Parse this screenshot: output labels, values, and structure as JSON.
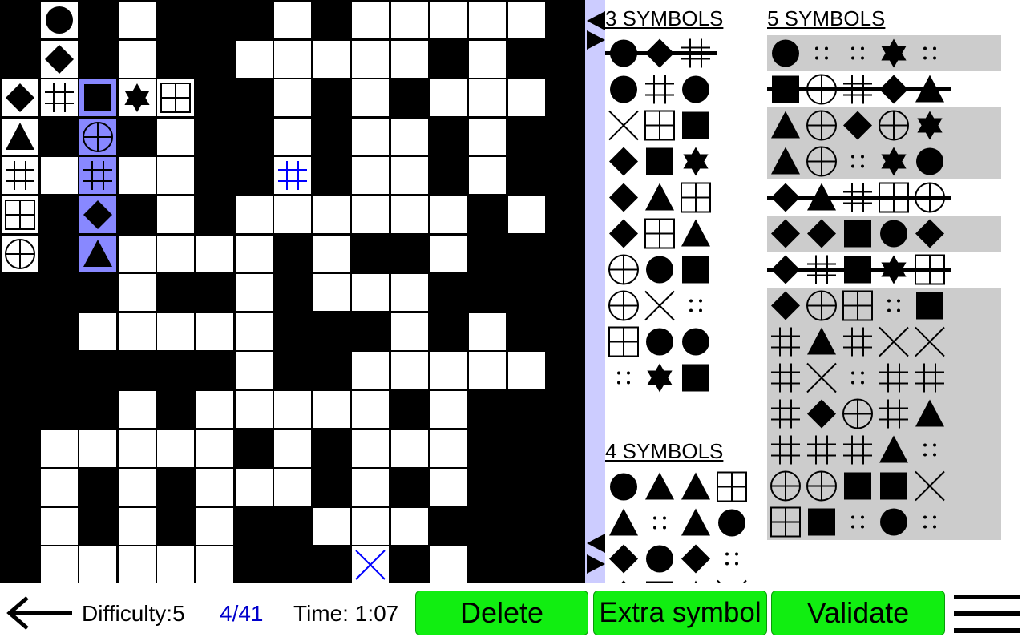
{
  "game": {
    "board": {
      "rows": [
        "#O#.###.#.....",
        "#D#.##.....#.#",
        "DHS*G##.#.#...",
        "T#C#.##.#..#.#",
        "H.H..##h#..#.#",
        "G#D#.#......#.",
        "C#T....#.##.##",
        "###.##.#...###",
        "##.....###.#.#",
        "######.##.....",
        "###.#.....#.##",
        "#.....#.#...##",
        "#.#.#...#.#.##",
        "#.#.#.##...###",
        "#.....###x#.##"
      ],
      "highlighted_column": 2,
      "highlighted_rows": [
        2,
        3,
        4,
        5,
        6
      ],
      "symbol_legend": {
        "O": "circle",
        "D": "diamond",
        "S": "square",
        "*": "star",
        "G": "grid",
        "C": "crossed-circle",
        "T": "triangle",
        "H": "hash",
        "X": "cross",
        ":": "dots",
        "h": "hash-blue",
        "x": "cross-blue"
      }
    },
    "word_lists": {
      "three": {
        "title": "3 SYMBOLS",
        "words": [
          {
            "symbols": [
              "circle",
              "diamond",
              "hash"
            ],
            "struck": true
          },
          {
            "symbols": [
              "circle",
              "hash",
              "circle"
            ],
            "struck": false
          },
          {
            "symbols": [
              "cross",
              "grid",
              "square"
            ],
            "struck": false
          },
          {
            "symbols": [
              "diamond",
              "square",
              "star"
            ],
            "struck": false
          },
          {
            "symbols": [
              "diamond",
              "triangle",
              "grid"
            ],
            "struck": false
          },
          {
            "symbols": [
              "diamond",
              "grid",
              "triangle"
            ],
            "struck": false
          },
          {
            "symbols": [
              "crossed-circle",
              "circle",
              "square"
            ],
            "struck": false
          },
          {
            "symbols": [
              "crossed-circle",
              "cross",
              "dots"
            ],
            "struck": false
          },
          {
            "symbols": [
              "grid",
              "circle",
              "circle"
            ],
            "struck": false
          },
          {
            "symbols": [
              "dots",
              "star",
              "square"
            ],
            "struck": false
          }
        ]
      },
      "four": {
        "title": "4 SYMBOLS",
        "words": [
          {
            "symbols": [
              "circle",
              "triangle",
              "triangle",
              "grid"
            ],
            "struck": false
          },
          {
            "symbols": [
              "triangle",
              "dots",
              "triangle",
              "circle"
            ],
            "struck": false
          },
          {
            "symbols": [
              "diamond",
              "circle",
              "diamond",
              "dots"
            ],
            "struck": false
          },
          {
            "symbols": [
              "diamond",
              "square",
              "triangle",
              "cross"
            ],
            "struck": false
          }
        ]
      },
      "five": {
        "title": "5 SYMBOLS",
        "words": [
          {
            "symbols": [
              "circle",
              "dots",
              "dots",
              "star",
              "dots"
            ],
            "struck": false,
            "shaded": true
          },
          {
            "symbols": [
              "square",
              "crossed-circle",
              "hash",
              "diamond",
              "triangle"
            ],
            "struck": true,
            "shaded": false
          },
          {
            "symbols": [
              "triangle",
              "crossed-circle",
              "diamond",
              "crossed-circle",
              "star"
            ],
            "struck": false,
            "shaded": true
          },
          {
            "symbols": [
              "triangle",
              "crossed-circle",
              "dots",
              "star",
              "circle"
            ],
            "struck": false,
            "shaded": true
          },
          {
            "symbols": [
              "diamond",
              "triangle",
              "hash",
              "grid",
              "crossed-circle"
            ],
            "struck": true,
            "shaded": false
          },
          {
            "symbols": [
              "diamond",
              "diamond",
              "square",
              "circle",
              "diamond"
            ],
            "struck": false,
            "shaded": true
          },
          {
            "symbols": [
              "diamond",
              "hash",
              "square",
              "star",
              "grid"
            ],
            "struck": true,
            "shaded": false
          },
          {
            "symbols": [
              "diamond",
              "crossed-circle",
              "grid",
              "dots",
              "square"
            ],
            "struck": false,
            "shaded": true
          },
          {
            "symbols": [
              "hash",
              "triangle",
              "hash",
              "cross",
              "cross"
            ],
            "struck": false,
            "shaded": true
          },
          {
            "symbols": [
              "hash",
              "cross",
              "dots",
              "hash",
              "hash"
            ],
            "struck": false,
            "shaded": true
          },
          {
            "symbols": [
              "hash",
              "diamond",
              "crossed-circle",
              "hash",
              "triangle"
            ],
            "struck": false,
            "shaded": true
          },
          {
            "symbols": [
              "hash",
              "hash",
              "hash",
              "triangle",
              "dots"
            ],
            "struck": false,
            "shaded": true
          },
          {
            "symbols": [
              "crossed-circle",
              "crossed-circle",
              "square",
              "square",
              "cross"
            ],
            "struck": false,
            "shaded": true
          },
          {
            "symbols": [
              "grid",
              "square",
              "dots",
              "circle",
              "dots"
            ],
            "struck": false,
            "shaded": true
          }
        ]
      }
    }
  },
  "bottom_bar": {
    "back_icon": "left-arrow-icon",
    "difficulty": "Difficulty:5",
    "progress": "4/41",
    "time": "Time: 1:07",
    "delete_label": "Delete",
    "extra_label": "Extra symbol",
    "validate_label": "Validate",
    "menu_icon": "hamburger-menu-icon"
  },
  "colors": {
    "highlight": "#8888ff",
    "divider": "#ccccff",
    "button_green": "#11ee11",
    "progress_blue": "#0000cc",
    "shaded_row": "#cccccc",
    "placed_symbol_blue": "#0000ff"
  }
}
